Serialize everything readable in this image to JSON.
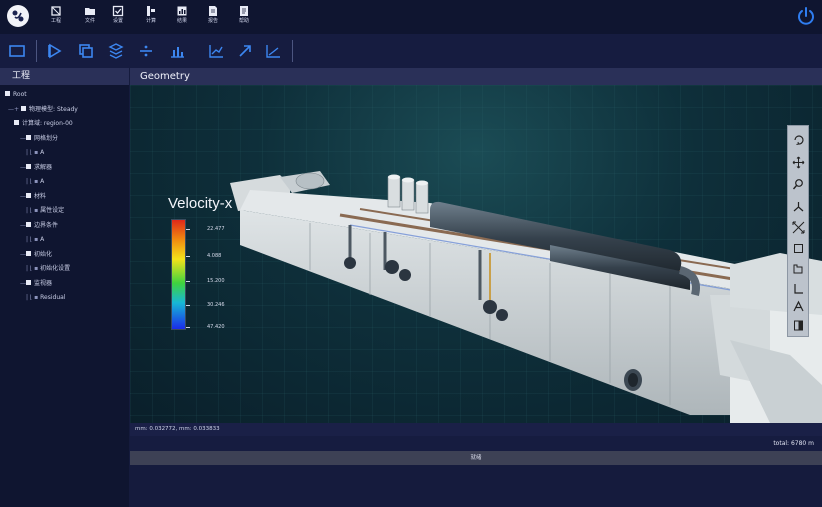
{
  "menu": {
    "items": [
      {
        "label": "工程",
        "icon": "project-icon"
      },
      {
        "label": "文件",
        "icon": "folder-icon"
      },
      {
        "label": "设置",
        "icon": "settings-check-icon"
      },
      {
        "label": "计算",
        "icon": "compute-icon"
      },
      {
        "label": "结果",
        "icon": "results-icon"
      },
      {
        "label": "报告",
        "icon": "report-icon"
      },
      {
        "label": "帮助",
        "icon": "help-icon"
      }
    ]
  },
  "left_panel": {
    "title": "工程",
    "tree": [
      {
        "text": "Root",
        "level": 0
      },
      {
        "text": "物理模型: Steady",
        "level": 1
      },
      {
        "text": "计算域: region-00",
        "level": 2
      },
      {
        "text": "网格划分",
        "level": 3
      },
      {
        "text": "A",
        "level": 4
      },
      {
        "text": "求解器",
        "level": 3
      },
      {
        "text": "A",
        "level": 4
      },
      {
        "text": "材料",
        "level": 3
      },
      {
        "text": "属性设定",
        "level": 4
      },
      {
        "text": "边界条件",
        "level": 3
      },
      {
        "text": "A",
        "level": 4
      },
      {
        "text": "初始化",
        "level": 3
      },
      {
        "text": "初始化设置",
        "level": 4
      },
      {
        "text": "监视器",
        "level": 3
      },
      {
        "text": "Residual",
        "level": 4
      }
    ]
  },
  "view": {
    "title": "Geometry",
    "legend": {
      "title": "Velocity-x",
      "ticks": [
        "22.477",
        "4.088",
        "15.200",
        "30.246",
        "47.420"
      ]
    }
  },
  "status": {
    "line": "mm:  0.032772, mm:  0.033833",
    "total": "total: 6780 m",
    "progress_label": "就绪",
    "progress": 0
  }
}
